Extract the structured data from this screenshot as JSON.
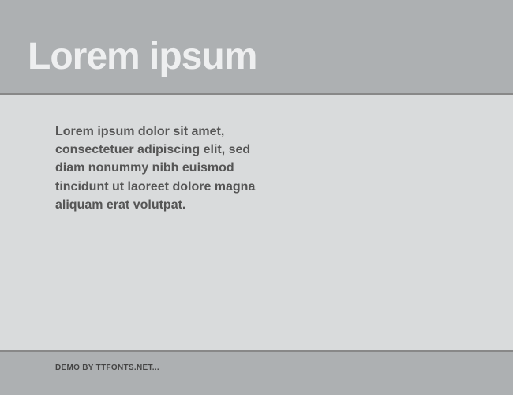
{
  "header": {
    "title": "Lorem ipsum"
  },
  "content": {
    "body": "Lorem ipsum dolor sit amet, consectetuer adipiscing elit, sed diam nonummy nibh euismod tincidunt ut laoreet dolore magna aliquam erat volutpat."
  },
  "footer": {
    "attribution": "DEMO BY TTFONTS.NET..."
  }
}
